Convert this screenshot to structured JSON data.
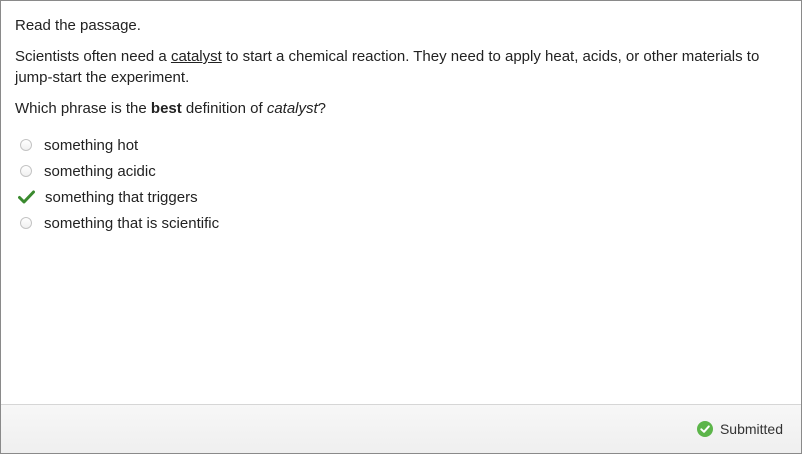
{
  "passage": {
    "instruction": "Read the passage.",
    "text_before": "Scientists often need a ",
    "keyword": "catalyst",
    "text_after": " to start a chemical reaction. They need to apply heat, acids, or other materials to jump-start the experiment."
  },
  "question": {
    "prefix": "Which phrase is the ",
    "emphasis": "best",
    "middle": " definition of ",
    "term": "catalyst",
    "suffix": "?"
  },
  "options": [
    {
      "label": "something hot",
      "selected": false
    },
    {
      "label": "something acidic",
      "selected": false
    },
    {
      "label": "something that triggers",
      "selected": true
    },
    {
      "label": "something that is scientific",
      "selected": false
    }
  ],
  "footer": {
    "status_label": "Submitted",
    "status_icon": "check-circle-icon"
  },
  "colors": {
    "check_green": "#3a8a2e",
    "status_green": "#5cb54a"
  }
}
